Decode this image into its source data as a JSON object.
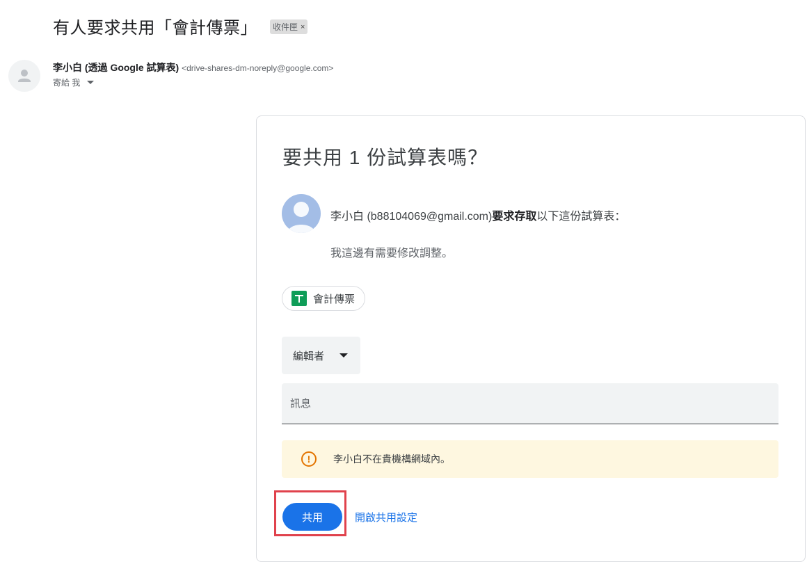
{
  "email": {
    "subject": "有人要求共用「會計傳票」",
    "label": "收件匣",
    "label_remove": "×",
    "sender_name": "李小白 (透過 Google 試算表)",
    "sender_email": "<drive-shares-dm-noreply@google.com>",
    "to": "寄給 我"
  },
  "card": {
    "title": "要共用 1 份試算表嗎？",
    "requester": "李小白 (b88104069@gmail.com)",
    "request_action": "要求存取",
    "request_suffix": "以下這份試算表：",
    "message": "我這邊有需要修改調整。",
    "file_name": "會計傳票",
    "role": "編輯者",
    "message_placeholder": "訊息",
    "warning": "李小白不在貴機構網域內。",
    "warning_icon": "!",
    "share_button": "共用",
    "settings_link": "開啟共用設定"
  },
  "colors": {
    "primary": "#1a73e8",
    "sheets_green": "#0f9d58",
    "warning_bg": "#fef7e0",
    "warning_icon": "#e37400",
    "highlight": "#e0424c"
  },
  "icons": [
    "person-avatar-icon",
    "caret-down-icon",
    "sheets-icon",
    "dropdown-arrow-icon",
    "warning-icon"
  ]
}
